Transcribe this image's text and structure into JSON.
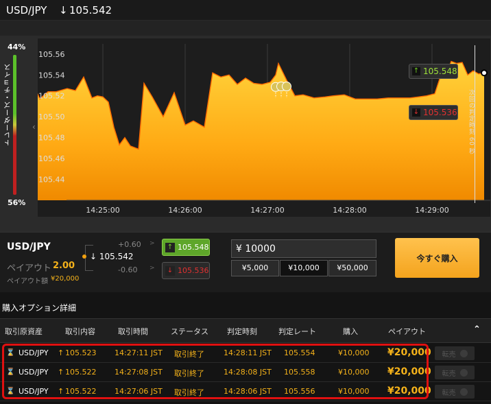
{
  "header": {
    "pair": "USD/JPY",
    "arrow": "↓",
    "price": "105.542"
  },
  "gauge": {
    "top_pct": "44%",
    "bottom_pct": "56%",
    "label": "トレーダーズ・チョイス",
    "caret": "‹"
  },
  "chart": {
    "next_judge_label": "次回の判定時刻 60 秒",
    "tag_up": {
      "arrow": "↑",
      "price": "105.548"
    },
    "tag_down": {
      "arrow": "↓",
      "price": "105.536"
    }
  },
  "chart_data": {
    "type": "area",
    "title": "",
    "ylim": [
      105.42,
      105.575
    ],
    "yticks": [
      "105.56",
      "105.54",
      "105.52",
      "105.50",
      "105.48",
      "105.46",
      "105.44"
    ],
    "xticks": [
      "14:25:00",
      "14:26:00",
      "14:27:00",
      "14:28:00",
      "14:29:00"
    ],
    "x_seconds_from_1424": [
      0,
      8,
      14,
      20,
      26,
      34,
      40,
      46,
      52,
      56,
      60,
      64,
      68,
      72,
      76,
      80,
      86,
      90,
      96,
      104,
      112,
      120,
      126,
      134,
      140,
      146,
      152,
      158,
      164,
      170,
      176,
      182,
      186,
      188,
      194,
      200,
      206,
      214,
      222,
      228,
      236,
      244,
      252,
      260,
      268,
      276,
      284,
      290,
      296,
      302,
      306,
      310,
      314,
      318,
      322,
      326,
      330,
      334,
      338
    ],
    "y": [
      105.53,
      105.535,
      105.517,
      105.524,
      105.524,
      105.527,
      105.525,
      105.538,
      105.518,
      105.52,
      105.519,
      105.514,
      105.49,
      105.473,
      105.48,
      105.472,
      105.469,
      105.532,
      105.519,
      105.5,
      105.523,
      105.492,
      105.496,
      105.49,
      105.542,
      105.538,
      105.54,
      105.531,
      105.537,
      105.532,
      105.531,
      105.533,
      105.54,
      105.551,
      105.535,
      105.52,
      105.521,
      105.518,
      105.519,
      105.52,
      105.521,
      105.517,
      105.517,
      105.517,
      105.518,
      105.518,
      105.518,
      105.519,
      105.52,
      105.522,
      105.538,
      105.54,
      105.553,
      105.551,
      105.552,
      105.54,
      105.544,
      105.541,
      105.542
    ]
  },
  "trade": {
    "pair": "USD/JPY",
    "payout_label": "ペイアウト",
    "payout_value": "2.00",
    "payout_amount_label": "ペイアウト額",
    "payout_amount_value": "¥20,000",
    "plus": "+0.60",
    "minus": "-0.60",
    "gt": ">",
    "current_arrow": "↓",
    "current_price": "105.542",
    "high_price": "105.548",
    "low_price": "105.536",
    "amount_value": "¥ 10000",
    "amounts": [
      "¥5,000",
      "¥10,000",
      "¥50,000"
    ],
    "buy_now": "今すぐ購入"
  },
  "details": {
    "title": "購入オプション詳細",
    "columns": [
      "取引原資産",
      "取引内容",
      "取引時間",
      "ステータス",
      "判定時刻",
      "判定レート",
      "購入",
      "ペイアウト"
    ],
    "collapse_icon": "⌃",
    "resale_label": "転売",
    "rows": [
      {
        "asset": "USD/JPY",
        "arrow": "↑",
        "content": "105.523",
        "time": "14:27:11 JST",
        "status": "取引終了",
        "judge_time": "14:28:11 JST",
        "judge_rate": "105.554",
        "purchase": "¥10,000",
        "payout": "¥20,000"
      },
      {
        "asset": "USD/JPY",
        "arrow": "↑",
        "content": "105.522",
        "time": "14:27:08 JST",
        "status": "取引終了",
        "judge_time": "14:28:08 JST",
        "judge_rate": "105.558",
        "purchase": "¥10,000",
        "payout": "¥20,000"
      },
      {
        "asset": "USD/JPY",
        "arrow": "↑",
        "content": "105.522",
        "time": "14:27:06 JST",
        "status": "取引終了",
        "judge_time": "14:28:06 JST",
        "judge_rate": "105.556",
        "purchase": "¥10,000",
        "payout": "¥20,000"
      }
    ]
  },
  "colors": {
    "accent": "#f5b21a",
    "up": "#7fd030",
    "down": "#e23030",
    "highlight": "#e01010"
  }
}
